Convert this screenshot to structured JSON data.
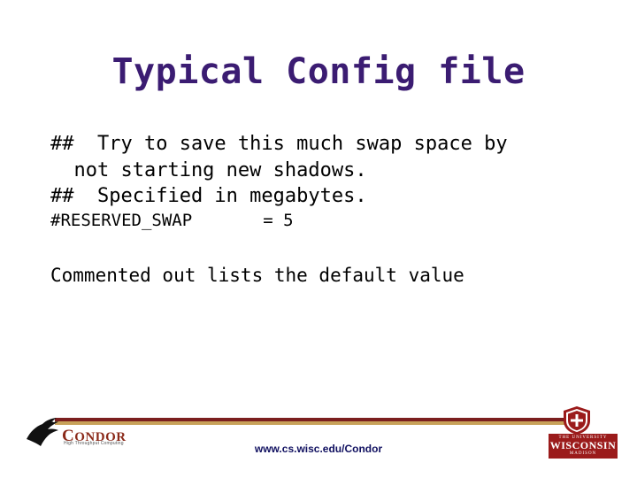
{
  "slide": {
    "title": "Typical Config file",
    "code_lines": [
      "##  Try to save this much swap space by",
      "  not starting new shadows.",
      "##  Specified in megabytes.",
      "#RESERVED_SWAP       = 5"
    ],
    "note": "Commented out lists the default value"
  },
  "footer": {
    "url": "www.cs.wisc.edu/Condor",
    "condor_logo": {
      "cap": "C",
      "word": "ONDOR",
      "tagline": "High Throughput Computing"
    },
    "wisconsin_logo": {
      "top_line": "THE UNIVERSITY",
      "main_line": "WISCONSIN",
      "bottom_line": "MADISON"
    },
    "colors": {
      "rule_top": "#7b1f1f",
      "rule_bottom": "#c8a25a",
      "title": "#3b1c72",
      "url": "#101060",
      "crest_red": "#9b1b1b"
    }
  }
}
